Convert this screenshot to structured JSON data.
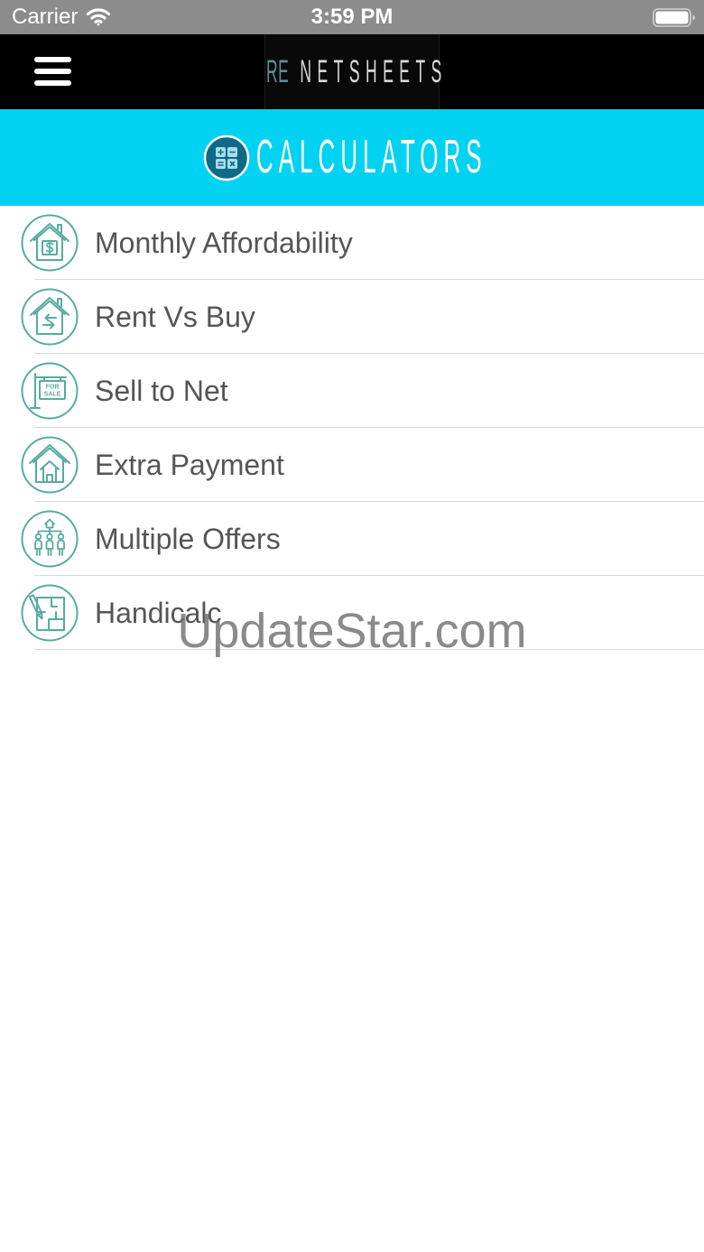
{
  "status_bar": {
    "carrier": "Carrier",
    "time": "3:59 PM",
    "wifi_icon": "wifi-icon",
    "battery_icon": "battery-icon",
    "battery_level": 1
  },
  "nav_bar": {
    "menu_icon": "hamburger-menu-icon",
    "logo": {
      "prefix": "RE",
      "name": "NETSHEETS"
    }
  },
  "header": {
    "icon": "calculator-icon",
    "title": "CALCULATORS"
  },
  "calculators": {
    "items": [
      {
        "label": "Monthly Affordability",
        "icon": "house-dollar-icon"
      },
      {
        "label": "Rent Vs Buy",
        "icon": "house-exchange-arrows-icon"
      },
      {
        "label": "Sell to Net",
        "icon": "for-sale-sign-icon",
        "icon_text": [
          "FOR",
          "SALE"
        ]
      },
      {
        "label": "Extra Payment",
        "icon": "house-in-house-icon"
      },
      {
        "label": "Multiple Offers",
        "icon": "multiple-buyers-icon"
      },
      {
        "label": "Handicalc",
        "icon": "floor-plan-pencil-icon"
      }
    ]
  },
  "watermark": "UpdateStar.com",
  "colors": {
    "status_bar": "#8c8c8c",
    "nav_bar": "#000000",
    "header": "#02d2f1",
    "icon_accent": "#58ab9f",
    "label_text": "#555555",
    "logo_prefix": "#5f8f93",
    "logo_name": "#d9d9d9"
  }
}
